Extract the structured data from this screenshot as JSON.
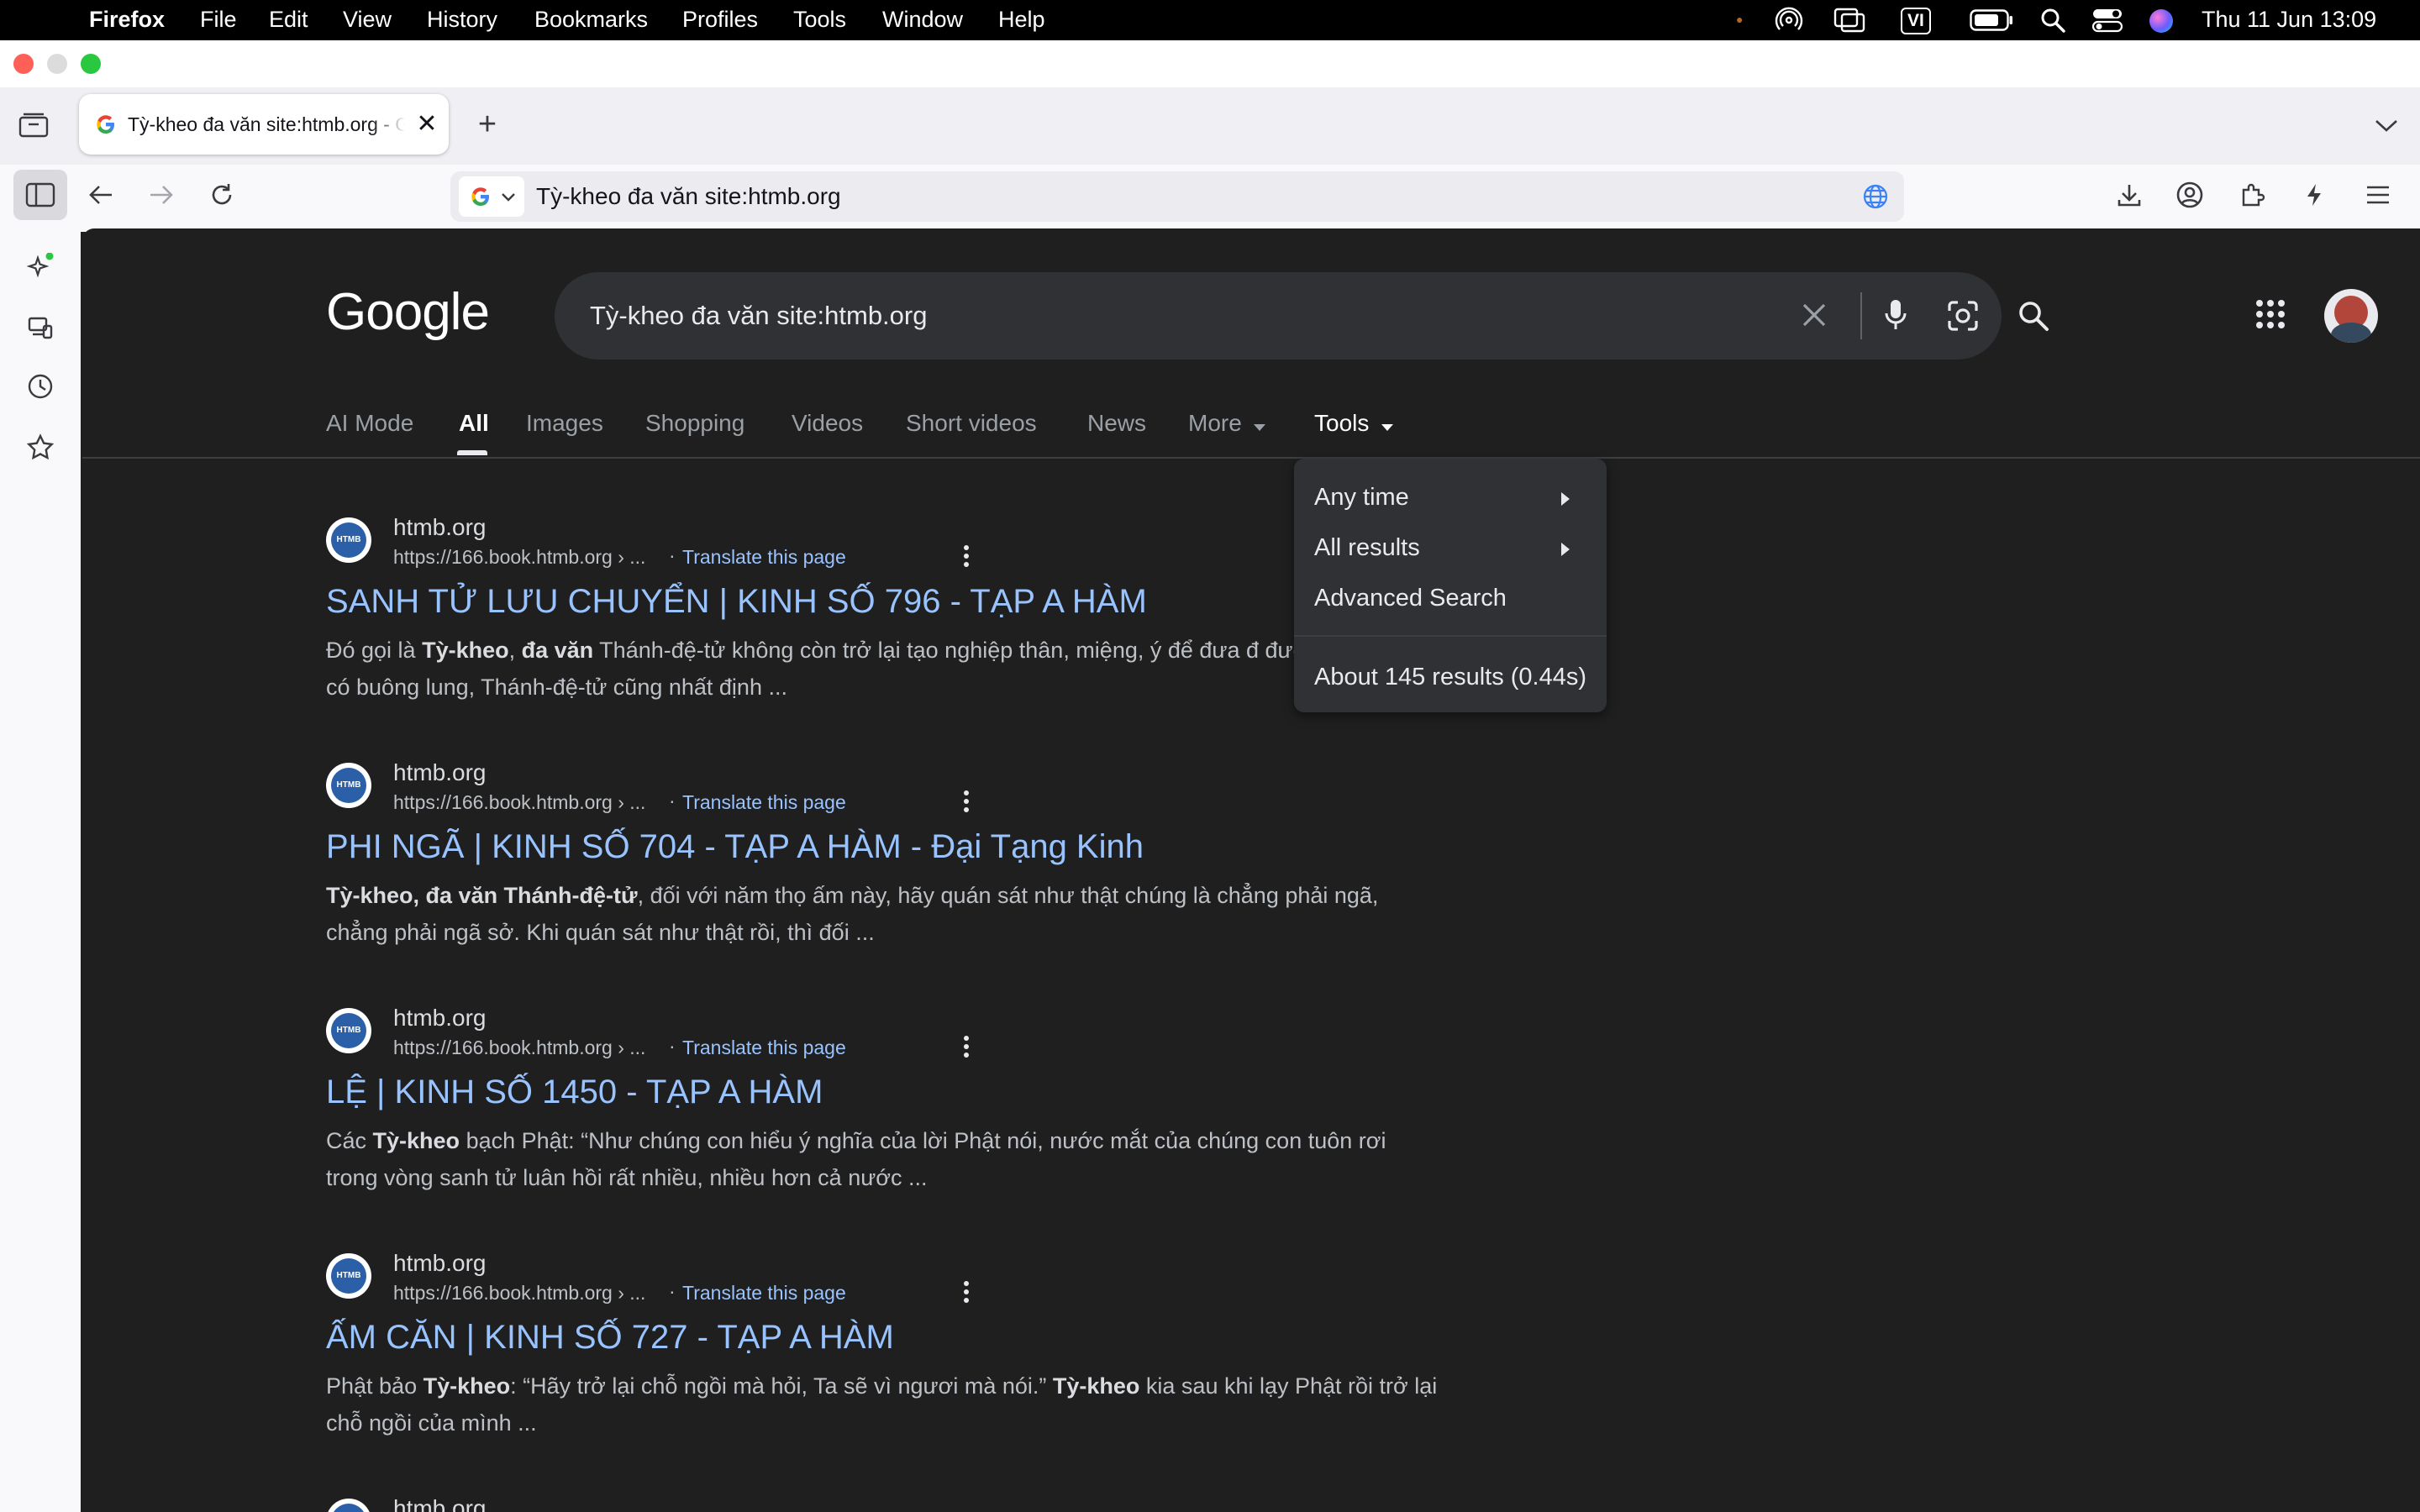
{
  "menubar": {
    "app": "Firefox",
    "items": [
      "File",
      "Edit",
      "View",
      "History",
      "Bookmarks",
      "Profiles",
      "Tools",
      "Window",
      "Help"
    ],
    "input_source": "VI",
    "clock": "Thu 11 Jun  13:09"
  },
  "browser": {
    "tab_title": "Tỳ-kheo đa văn site:htmb.org - Google",
    "url": "Tỳ-kheo đa văn site:htmb.org"
  },
  "google": {
    "logo": "Google",
    "query": "Tỳ-kheo đa văn site:htmb.org",
    "nav": [
      {
        "label": "AI Mode"
      },
      {
        "label": "All"
      },
      {
        "label": "Images"
      },
      {
        "label": "Shopping"
      },
      {
        "label": "Videos"
      },
      {
        "label": "Short videos"
      },
      {
        "label": "News"
      },
      {
        "label": "More"
      },
      {
        "label": "Tools"
      }
    ],
    "tools_menu": {
      "any_time": "Any time",
      "all_results": "All results",
      "advanced_search": "Advanced Search",
      "stats": "About 145 results (0.44s)"
    },
    "results": [
      {
        "site": "htmb.org",
        "url": "https://166.book.htmb.org › ...",
        "translate": "Translate this page",
        "title": "SANH TỬ LƯU CHUYỂN | KINH SỐ 796 - TẠP A HÀM",
        "snippet_html": "Đó gọi là <b>Tỳ-kheo</b>, <b>đa văn</b> Thánh-đệ-tử không còn trở lại tạo nghiệp thân, miệng, ý để đưa đ đường ác; giả sử có buông lung, Thánh-đệ-tử cũng nhất định ..."
      },
      {
        "site": "htmb.org",
        "url": "https://166.book.htmb.org › ...",
        "translate": "Translate this page",
        "title": "PHI NGÃ | KINH SỐ 704 - TẠP A HÀM - Đại Tạng Kinh",
        "snippet_html": "<b>Tỳ-kheo, đa văn Thánh-đệ-tử</b>, đối với năm thọ ấm này, hãy quán sát như thật chúng là chẳng phải ngã, chẳng phải ngã sở. Khi quán sát như thật rồi, thì đối ..."
      },
      {
        "site": "htmb.org",
        "url": "https://166.book.htmb.org › ...",
        "translate": "Translate this page",
        "title": "LỆ | KINH SỐ 1450 - TẠP A HÀM",
        "snippet_html": "Các <b>Tỳ-kheo</b> bạch Phật: “Như chúng con hiểu ý nghĩa của lời Phật nói, nước mắt của chúng con tuôn rơi trong vòng sanh tử luân hồi rất nhiều, nhiều hơn cả nước ..."
      },
      {
        "site": "htmb.org",
        "url": "https://166.book.htmb.org › ...",
        "translate": "Translate this page",
        "title": "ẤM CĂN | KINH SỐ 727 - TẠP A HÀM",
        "snippet_html": "Phật bảo <b>Tỳ-kheo</b>: “Hãy trở lại chỗ ngồi mà hỏi, Ta sẽ vì ngươi mà nói.” <b>Tỳ-kheo</b> kia sau khi lạy Phật rồi trở lại chỗ ngồi của mình ..."
      },
      {
        "site": "htmb.org"
      }
    ]
  }
}
